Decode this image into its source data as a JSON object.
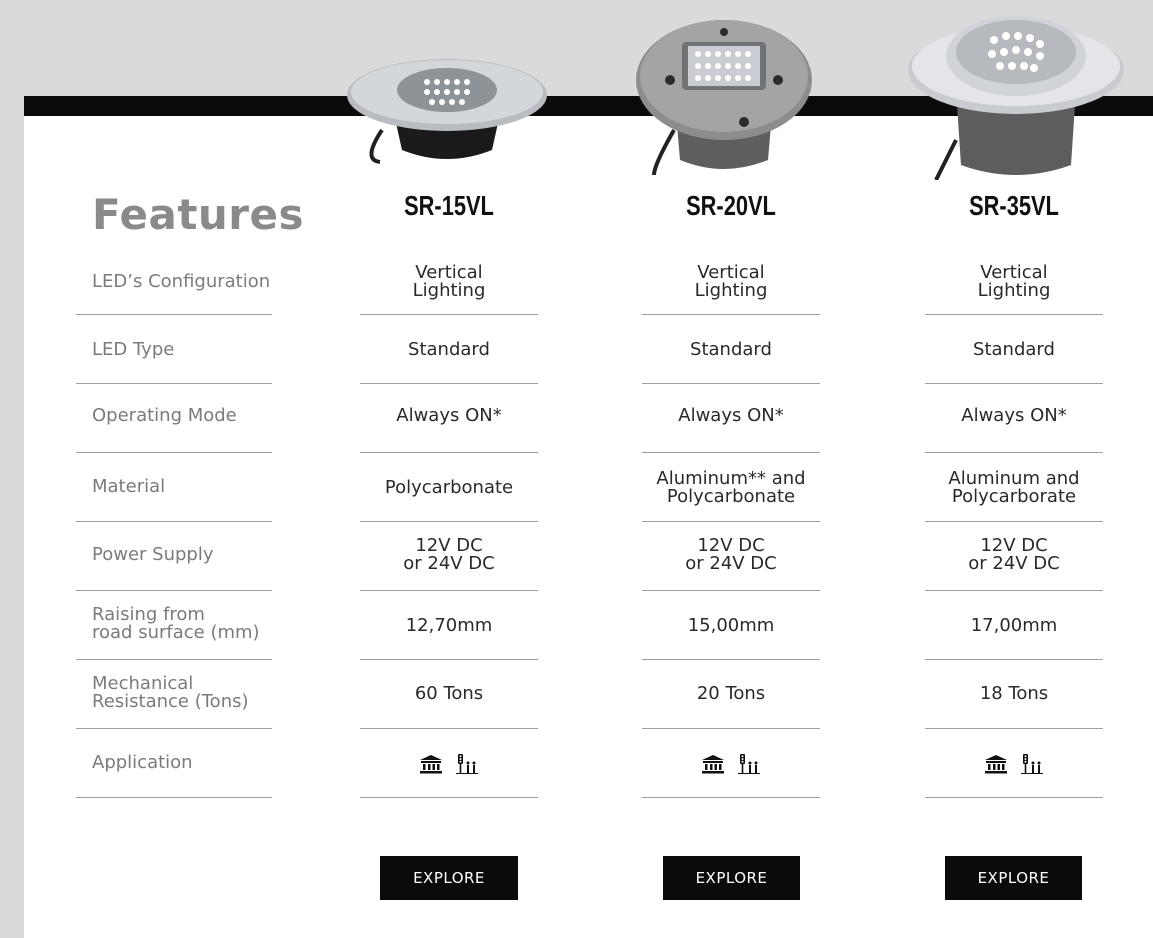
{
  "features_title": "Features",
  "feature_labels": [
    "LED’s Configuration",
    "LED Type",
    "Operating Mode",
    "Material",
    "Power Supply",
    "Raising from\nroad surface (mm)",
    "Mechanical\nResistance (Tons)",
    "Application"
  ],
  "products": [
    {
      "name": "SR-15VL",
      "config": "Vertical\nLighting",
      "led_type": "Standard",
      "mode": "Always ON*",
      "material": "Polycarbonate",
      "power": "12V DC\nor 24V DC",
      "raising": "12,70mm",
      "resistance": "60 Tons",
      "application_icons": [
        "museum-icon",
        "traffic-pedestrian-icon"
      ],
      "explore_label": "EXPLORE"
    },
    {
      "name": "SR-20VL",
      "config": "Vertical\nLighting",
      "led_type": "Standard",
      "mode": "Always ON*",
      "material": "Aluminum** and\nPolycarbonate",
      "power": "12V DC\nor 24V DC",
      "raising": "15,00mm",
      "resistance": "20 Tons",
      "application_icons": [
        "museum-icon",
        "traffic-pedestrian-icon"
      ],
      "explore_label": "EXPLORE"
    },
    {
      "name": "SR-35VL",
      "config": "Vertical\nLighting",
      "led_type": "Standard",
      "mode": "Always ON*",
      "material": "Aluminum and\nPolycarborate",
      "power": "12V DC\nor 24V DC",
      "raising": "17,00mm",
      "resistance": "18 Tons",
      "application_icons": [
        "museum-icon",
        "traffic-pedestrian-icon"
      ],
      "explore_label": "EXPLORE"
    }
  ],
  "colors": {
    "background": "#d9dadc",
    "card": "#ffffff",
    "bar": "#0b0b0b",
    "label": "#7b7b7b",
    "title": "#8a8a8a"
  }
}
